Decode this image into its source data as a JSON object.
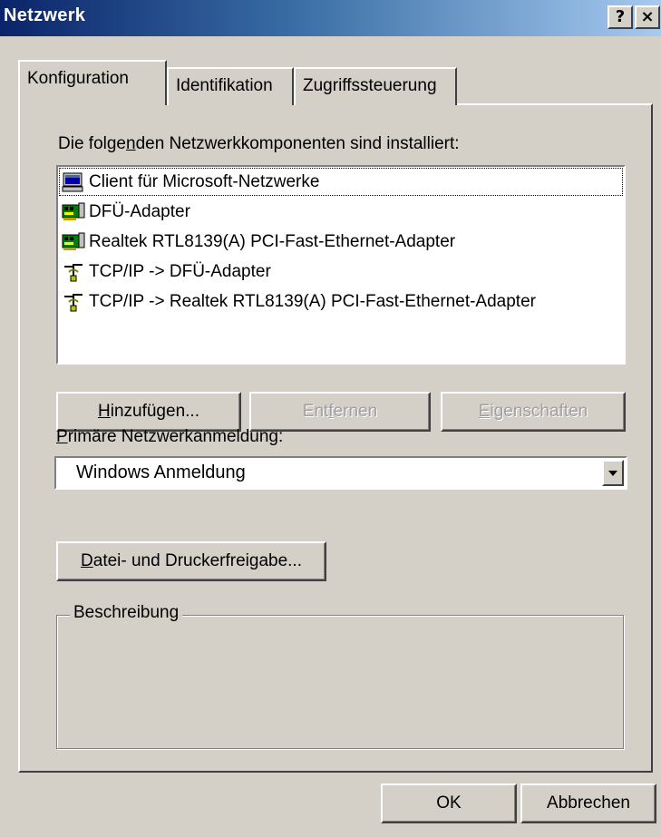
{
  "window": {
    "title": "Netzwerk",
    "help_label": "?",
    "close_label": "×"
  },
  "tabs": [
    {
      "label": "Konfiguration",
      "active": true
    },
    {
      "label": "Identifikation",
      "active": false
    },
    {
      "label": "Zugriffssteuerung",
      "active": false
    }
  ],
  "components": {
    "heading_pre": "Die folge",
    "heading_accel": "n",
    "heading_post": "den Netzwerkkomponenten sind installiert:",
    "items": [
      {
        "label": "Client für Microsoft-Netzwerke",
        "icon": "network-client-icon",
        "selected": true
      },
      {
        "label": "DFÜ-Adapter",
        "icon": "network-adapter-icon",
        "selected": false
      },
      {
        "label": "Realtek RTL8139(A) PCI-Fast-Ethernet-Adapter",
        "icon": "network-adapter-icon",
        "selected": false
      },
      {
        "label": "TCP/IP -> DFÜ-Adapter",
        "icon": "protocol-icon",
        "selected": false
      },
      {
        "label": "TCP/IP -> Realtek RTL8139(A) PCI-Fast-Ethernet-Adapter",
        "icon": "protocol-icon",
        "selected": false
      }
    ]
  },
  "buttons": {
    "add_accel": "H",
    "add_rest": "inzufügen...",
    "remove_pre": "Ent",
    "remove_accel": "f",
    "remove_post": "ernen",
    "properties_accel": "E",
    "properties_rest": "igenschaften",
    "file_share_accel": "D",
    "file_share_rest": "atei- und Druckerfreigabe...",
    "ok_label": "OK",
    "cancel_label": "Abbrechen"
  },
  "logon": {
    "label_accel": "P",
    "label_rest": "rimäre Netzwerkanmeldung:",
    "selected": "Windows Anmeldung"
  },
  "description": {
    "legend": "Beschreibung"
  },
  "colors": {
    "dialog_bg": "#d4d0c8",
    "titlebar_start": "#0a246a",
    "titlebar_end": "#a6caf0",
    "disabled_text": "#a0a0a0"
  }
}
